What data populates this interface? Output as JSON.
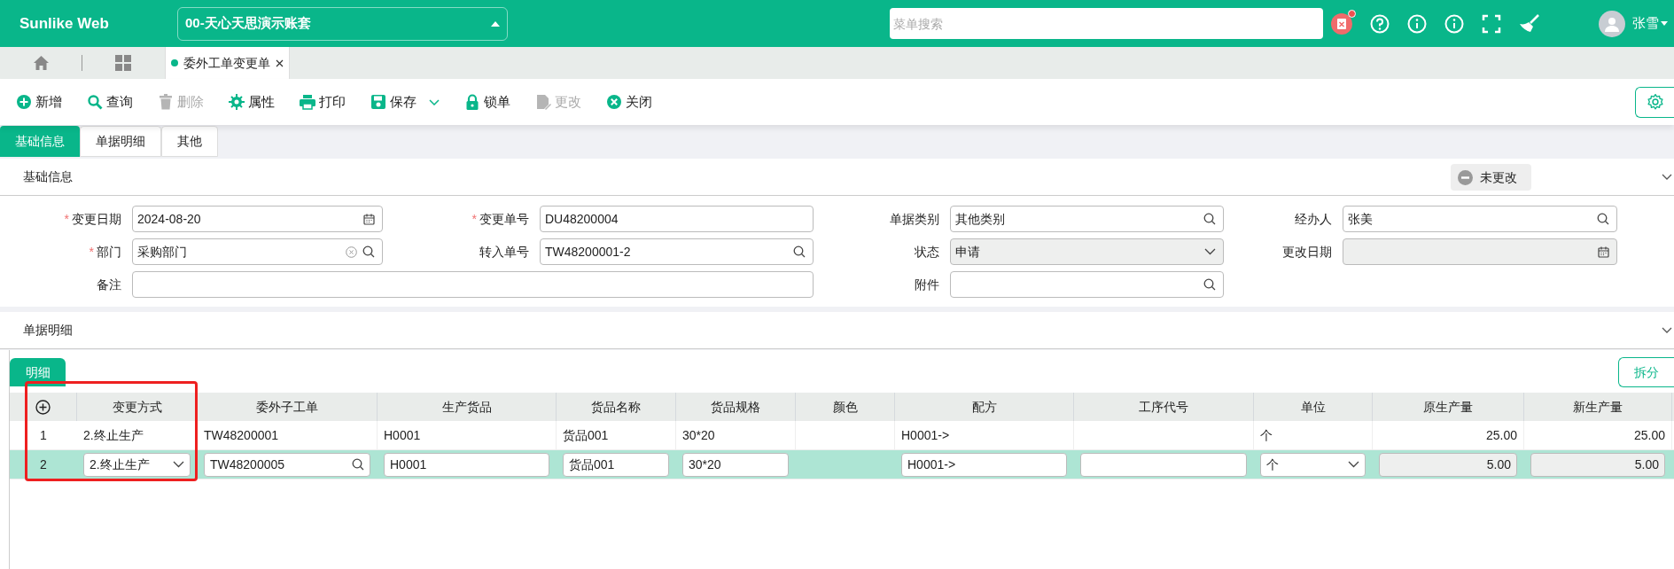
{
  "header": {
    "logo": "Sunlike Web",
    "account": "00-天心天思演示账套",
    "search_placeholder": "菜单搜索",
    "user": "张雪"
  },
  "tabs": [
    {
      "label": "委外工单变更单",
      "selected": true
    }
  ],
  "toolbar": [
    {
      "label": "新增",
      "kind": "add",
      "disabled": false,
      "dropdown": false
    },
    {
      "label": "查询",
      "kind": "search",
      "disabled": false,
      "dropdown": false
    },
    {
      "label": "删除",
      "kind": "trash",
      "disabled": true,
      "dropdown": false
    },
    {
      "label": "属性",
      "kind": "gear",
      "disabled": false,
      "dropdown": false
    },
    {
      "label": "打印",
      "kind": "print",
      "disabled": false,
      "dropdown": false
    },
    {
      "label": "保存",
      "kind": "save",
      "disabled": false,
      "dropdown": true
    },
    {
      "label": "锁单",
      "kind": "lock",
      "disabled": false,
      "dropdown": false
    },
    {
      "label": "更改",
      "kind": "edit",
      "disabled": true,
      "dropdown": false
    },
    {
      "label": "关闭",
      "kind": "close",
      "disabled": false,
      "dropdown": false
    }
  ],
  "subtabs": [
    {
      "label": "基础信息",
      "selected": true
    },
    {
      "label": "单据明细",
      "selected": false
    },
    {
      "label": "其他",
      "selected": false
    }
  ],
  "basic": {
    "title": "基础信息",
    "status": "未更改",
    "fields": [
      {
        "required_mark": "*",
        "label": "变更日期",
        "value": "2024-08-20",
        "kind": "date",
        "disabled": false
      },
      {
        "required_mark": "*",
        "label": "变更单号",
        "value": "DU48200004",
        "kind": "text",
        "disabled": false
      },
      {
        "label": "单据类别",
        "value": "其他类别",
        "kind": "lookup",
        "disabled": false
      },
      {
        "label": "经办人",
        "value": "张美",
        "kind": "lookup",
        "disabled": false
      },
      {
        "required_mark": "*",
        "label": "部门",
        "value": "采购部门",
        "kind": "clear-lookup",
        "disabled": false
      },
      {
        "label": "转入单号",
        "value": "TW48200001-2",
        "kind": "lookup",
        "disabled": false
      },
      {
        "label": "状态",
        "value": "申请",
        "kind": "select",
        "disabled": true
      },
      {
        "label": "更改日期",
        "kind": "date",
        "disabled": true
      },
      {
        "label": "备注",
        "kind": "text",
        "disabled": false,
        "colspan": 3
      },
      {
        "label": "附件",
        "kind": "lookup",
        "disabled": false
      }
    ]
  },
  "detail_section": {
    "title": "单据明细"
  },
  "grid": {
    "tab": "明细",
    "split_button": "拆分",
    "columns": [
      {
        "label": "变更方式",
        "kind": "select"
      },
      {
        "label": "委外子工单",
        "kind": "lookup"
      },
      {
        "label": "生产货品",
        "kind": "text"
      },
      {
        "label": "货品名称",
        "kind": "text"
      },
      {
        "label": "货品规格",
        "kind": "text"
      },
      {
        "label": "颜色",
        "kind": "plain"
      },
      {
        "label": "配方",
        "kind": "text"
      },
      {
        "label": "工序代号",
        "kind": "text"
      },
      {
        "label": "单位",
        "kind": "select"
      },
      {
        "label": "原生产量",
        "kind": "number"
      },
      {
        "label": "新生产量",
        "kind": "number"
      }
    ],
    "rows": [
      {
        "number": "1",
        "selected": false,
        "cells": [
          "2.终止生产",
          "TW48200001",
          "H0001",
          "货品001",
          "30*20",
          null,
          "H0001->",
          null,
          "个",
          "25.00",
          "25.00"
        ]
      },
      {
        "number": "2",
        "selected": true,
        "cells": [
          "2.终止生产",
          "TW48200005",
          "H0001",
          "货品001",
          "30*20",
          null,
          "H0001->",
          null,
          "个",
          "5.00",
          "5.00"
        ]
      }
    ]
  }
}
